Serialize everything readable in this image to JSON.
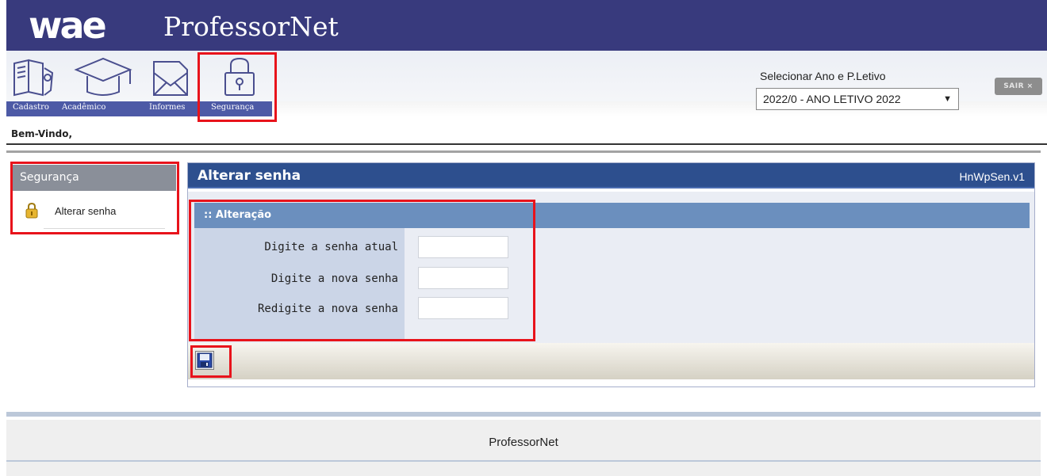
{
  "colors": {
    "brand_band": "#383a7d",
    "menu_strip": "#4d5aa6",
    "panel_header": "#2d4f8e",
    "fieldset_header": "#6b8fbe",
    "label_column": "#cbd5e7",
    "highlight": "#e8131b"
  },
  "header": {
    "logo": "wae",
    "app_name": "ProfessorNet",
    "welcome": "Bem-Vindo,",
    "period": {
      "label": "Selecionar Ano e P.Letivo",
      "selected": "2022/0 - ANO LETIVO 2022"
    },
    "logout_label": "SAIR ×"
  },
  "menu": [
    {
      "label": "Cadastro",
      "icon": "books-icon"
    },
    {
      "label": "Acadêmico",
      "icon": "graduation-cap-icon"
    },
    {
      "label": "Informes",
      "icon": "envelope-icon"
    },
    {
      "label": "Segurança",
      "icon": "padlock-icon"
    }
  ],
  "sidebar": {
    "title": "Segurança",
    "items": [
      {
        "label": "Alterar senha",
        "icon": "padlock-icon"
      }
    ]
  },
  "main": {
    "title": "Alterar senha",
    "code": "HnWpSen.v1",
    "fieldset": {
      "title": ":: Alteração",
      "fields": [
        {
          "label": "Digite a senha atual",
          "value": ""
        },
        {
          "label": "Digite a nova senha",
          "value": ""
        },
        {
          "label": "Redigite a nova senha",
          "value": ""
        }
      ]
    },
    "toolbar": {
      "save_icon": "floppy-disk-icon"
    }
  },
  "footer": {
    "text": "ProfessorNet"
  }
}
